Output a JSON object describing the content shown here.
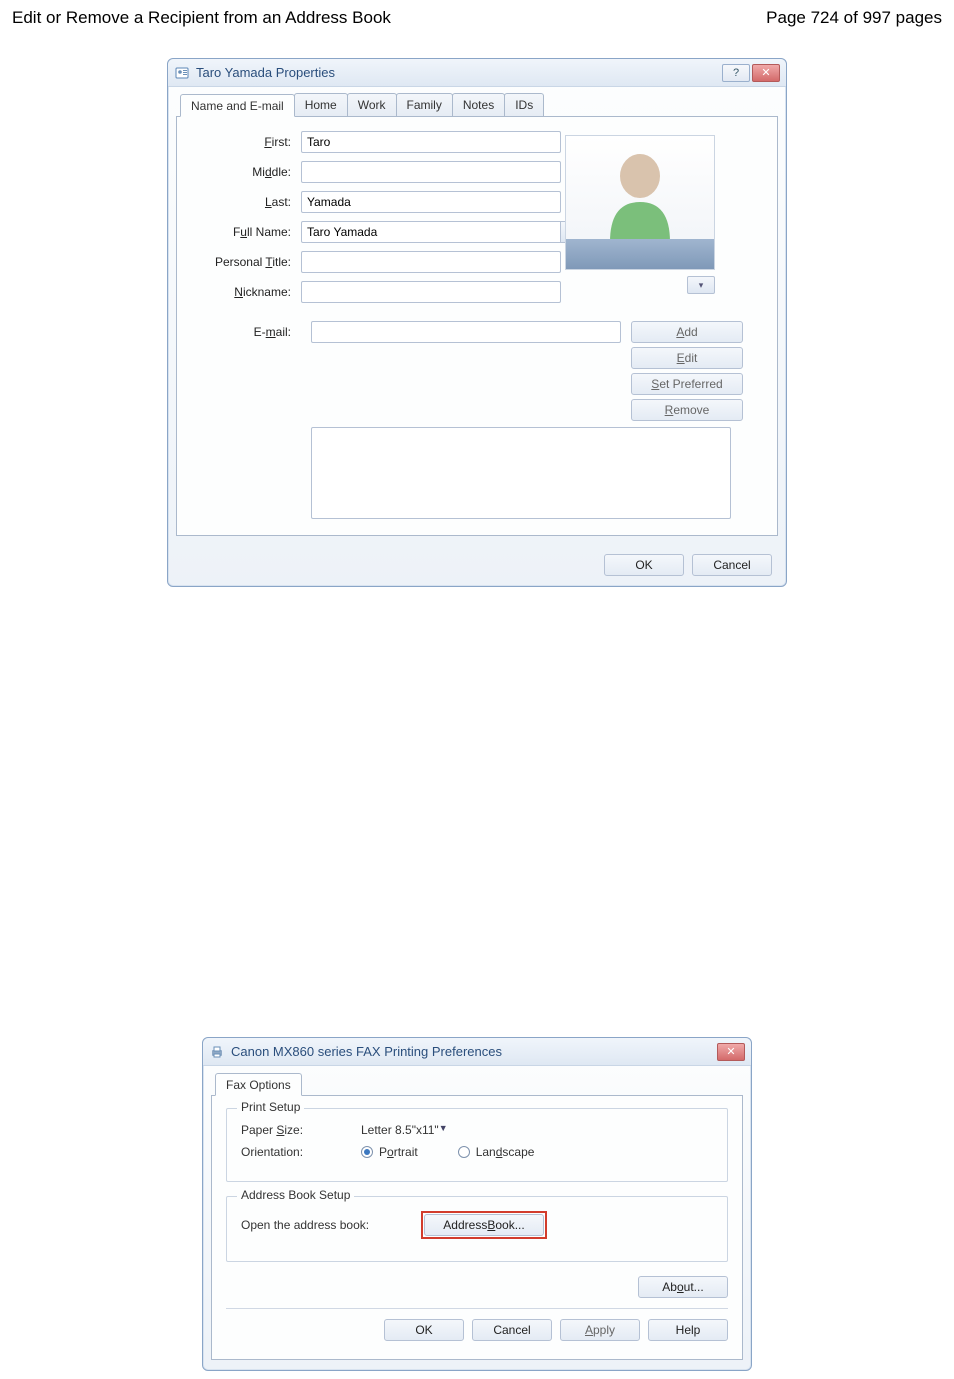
{
  "page": {
    "title_left": "Edit or Remove a Recipient from an Address Book",
    "title_right": "Page 724 of 997 pages"
  },
  "dlg1": {
    "title": "Taro Yamada Properties",
    "tabs": [
      "Name and E-mail",
      "Home",
      "Work",
      "Family",
      "Notes",
      "IDs"
    ],
    "labels": {
      "first": "First:",
      "middle": "Middle:",
      "last": "Last:",
      "fullname": "Full Name:",
      "ptitle": "Personal Title:",
      "nickname": "Nickname:",
      "email": "E-mail:"
    },
    "values": {
      "first": "Taro",
      "middle": "",
      "last": "Yamada",
      "fullname": "Taro Yamada",
      "ptitle": "",
      "nickname": "",
      "email": ""
    },
    "btns": {
      "add": "Add",
      "edit": "Edit",
      "setpref": "Set Preferred",
      "remove": "Remove",
      "ok": "OK",
      "cancel": "Cancel"
    }
  },
  "dlg2": {
    "title": "Canon MX860 series FAX Printing Preferences",
    "tab": "Fax Options",
    "group_print": "Print Setup",
    "group_addr": "Address Book Setup",
    "paper_label": "Paper Size:",
    "paper_value": "Letter 8.5\"x11\"",
    "orient_label": "Orientation:",
    "portrait": "Portrait",
    "landscape": "Landscape",
    "open_label": "Open the address book:",
    "addrbtn": "Address Book...",
    "about": "About...",
    "ok": "OK",
    "cancel": "Cancel",
    "apply": "Apply",
    "help": "Help"
  }
}
